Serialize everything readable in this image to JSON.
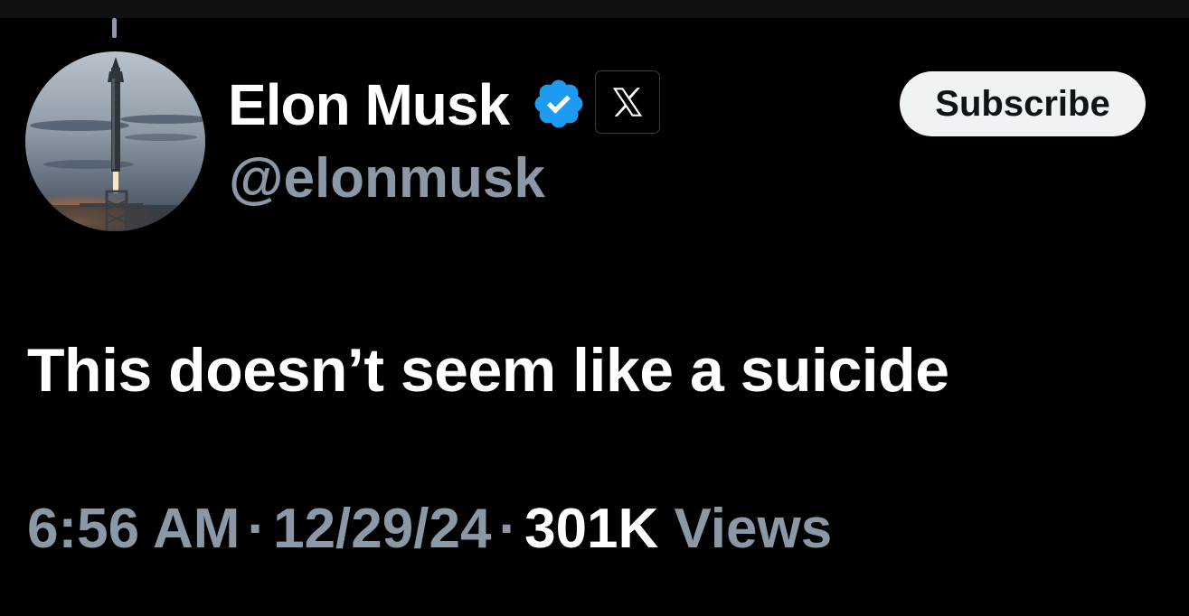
{
  "author": {
    "display_name": "Elon Musk",
    "handle": "@elonmusk",
    "verified_icon": "verified-check-icon",
    "affiliate_icon": "x-logo-icon",
    "verified_color": "#1d9bf0"
  },
  "actions": {
    "subscribe_label": "Subscribe"
  },
  "tweet": {
    "text": "This doesn’t seem like a suicide"
  },
  "meta": {
    "time": "6:56 AM",
    "separator": "·",
    "date": "12/29/24",
    "views_count": "301K",
    "views_label": "Views"
  },
  "colors": {
    "background": "#000000",
    "primary_text": "#ffffff",
    "secondary_text": "#8b98a5",
    "subscribe_bg": "#eff3f4"
  }
}
